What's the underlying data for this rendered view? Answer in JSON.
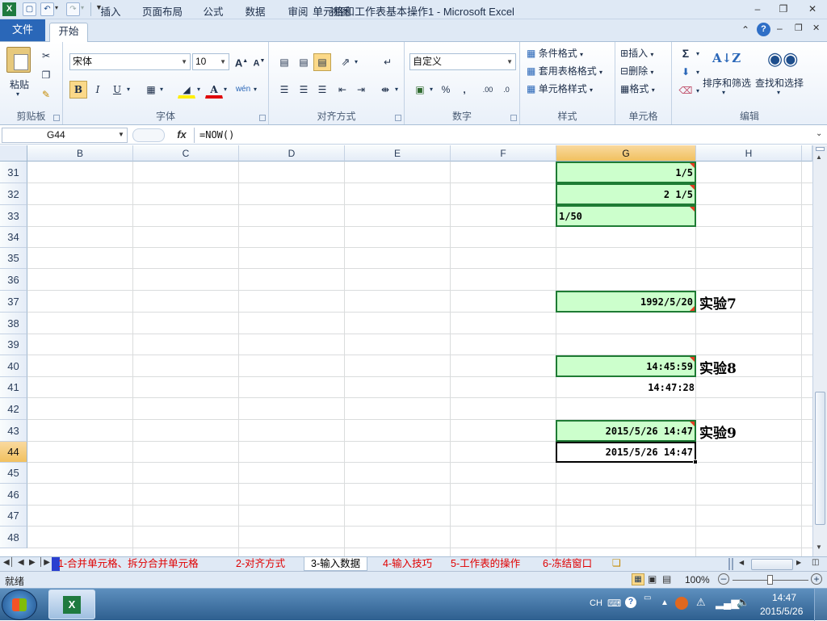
{
  "window": {
    "title": "单元格和工作表基本操作1 - Microsoft Excel"
  },
  "ribbon": {
    "file_tab": "文件",
    "tabs": [
      "开始",
      "插入",
      "页面布局",
      "公式",
      "数据",
      "审阅",
      "视图"
    ],
    "groups": {
      "clipboard": "剪贴板",
      "font": "字体",
      "alignment": "对齐方式",
      "number": "数字",
      "styles": "样式",
      "cells": "单元格",
      "editing": "编辑"
    },
    "clipboard": {
      "paste": "粘贴"
    },
    "font": {
      "name": "宋体",
      "size": "10"
    },
    "number": {
      "format": "自定义"
    },
    "styles": {
      "conditional": "条件格式",
      "table": "套用表格格式",
      "cell": "单元格样式"
    },
    "cells": {
      "insert": "插入",
      "delete": "删除",
      "format": "格式"
    },
    "editing": {
      "sort": "排序和筛选",
      "find": "查找和选择"
    }
  },
  "formula_bar": {
    "name_box": "G44",
    "fx": "fx",
    "formula": "=NOW()"
  },
  "grid": {
    "columns": [
      "B",
      "C",
      "D",
      "E",
      "F",
      "G",
      "H"
    ],
    "rows": [
      "31",
      "32",
      "33",
      "34",
      "35",
      "36",
      "37",
      "38",
      "39",
      "40",
      "41",
      "42",
      "43",
      "44",
      "45",
      "46",
      "47",
      "48"
    ],
    "cells": {
      "g31": "1/5",
      "g32": "2 1/5",
      "g33": "1/50",
      "g37": "1992/5/20",
      "h37": "实验7",
      "g40": "14:45:59",
      "h40": "实验8",
      "g41": "14:47:28",
      "g43": "2015/5/26 14:47",
      "h43": "实验9",
      "g44": "2015/5/26 14:47"
    }
  },
  "sheet_tabs": [
    "1-合并单元格、拆分合并单元格",
    "2-对齐方式",
    "3-输入数据",
    "4-输入技巧",
    "5-工作表的操作",
    "6-冻结窗口"
  ],
  "status": {
    "ready": "就绪",
    "zoom": "100%"
  },
  "taskbar": {
    "lang": "CH",
    "time": "14:47",
    "date": "2015/5/26"
  },
  "colors": {
    "accent": "#2a67b8",
    "cell_fill": "#ccffcc",
    "cell_border": "#1e7b34",
    "sheet_tab_text": "#e00000"
  }
}
